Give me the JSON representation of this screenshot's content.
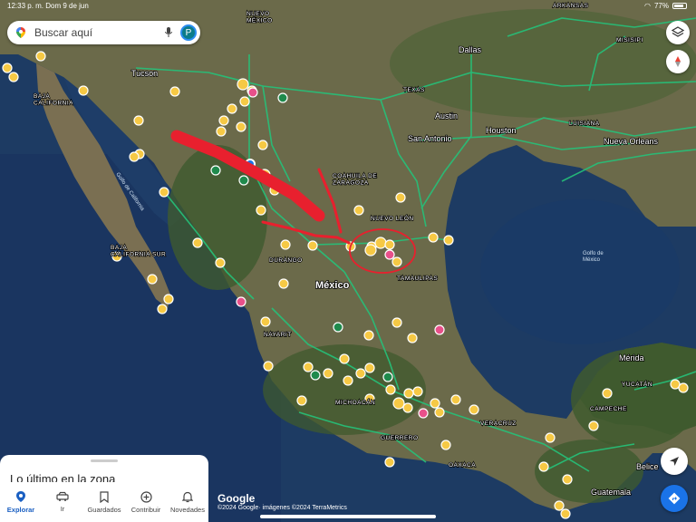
{
  "status_bar": {
    "time_date": "12:33 p. m.  Dom 9 de jun",
    "battery": "77%"
  },
  "search": {
    "placeholder": "Buscar aquí",
    "avatar_letter": "P"
  },
  "map_labels": {
    "nuevo_mexico": "NUEVO\nMÉXICO",
    "arkansas": "ARKANSAS",
    "misisipi": "MISISIPI",
    "dallas": "Dallas",
    "tucson": "Tucson",
    "texas": "TEXAS",
    "austin": "Austin",
    "luisiana": "LUISIANA",
    "baja_california": "BAJA\nCALIFORNIA",
    "houston": "Houston",
    "san_antonio": "San Antonio",
    "nueva_orleans": "Nueva Orleans",
    "golfo_california": "Golfo de California",
    "coahuila": "COAHUILA DE\nZARAGOZA",
    "nuevo_leon": "NUEVO LEÓN",
    "baja_california_sur": "BAJA\nCALIFORNIA SUR",
    "durango": "DURANGO",
    "golfo_mexico": "Golfo de\nMéxico",
    "tamaulipas": "TAMAULIPAS",
    "mexico": "México",
    "nayarit": "NAYARIT",
    "merida": "Mérida",
    "yucatan": "YUCATÁN",
    "michoacan": "MICHOACÁN",
    "campeche": "CAMPECHE",
    "veracruz": "VERACRUZ",
    "guerrero": "GUERRERO",
    "oaxaca": "OAXACA",
    "belice": "Belice",
    "guatemala": "Guatemala"
  },
  "sheet": {
    "title": "Lo último en la zona"
  },
  "tabs": [
    {
      "label": "Explorar",
      "icon": "pin-icon",
      "active": true
    },
    {
      "label": "Ir",
      "icon": "car-icon",
      "active": false
    },
    {
      "label": "Guardados",
      "icon": "bookmark-icon",
      "active": false
    },
    {
      "label": "Contribuir",
      "icon": "plus-circle-icon",
      "active": false
    },
    {
      "label": "Novedades",
      "icon": "bell-icon",
      "active": false
    }
  ],
  "footer": {
    "logo": "Google",
    "attribution": "©2024 Google· imágenes ©2024 TerraMetrics"
  },
  "colors": {
    "water": "#1d3b63",
    "land": "#6b6a4a",
    "forest": "#3f5a2e",
    "road": "#25c27a",
    "annotation": "#e8202e",
    "accent": "#1a73e8"
  }
}
